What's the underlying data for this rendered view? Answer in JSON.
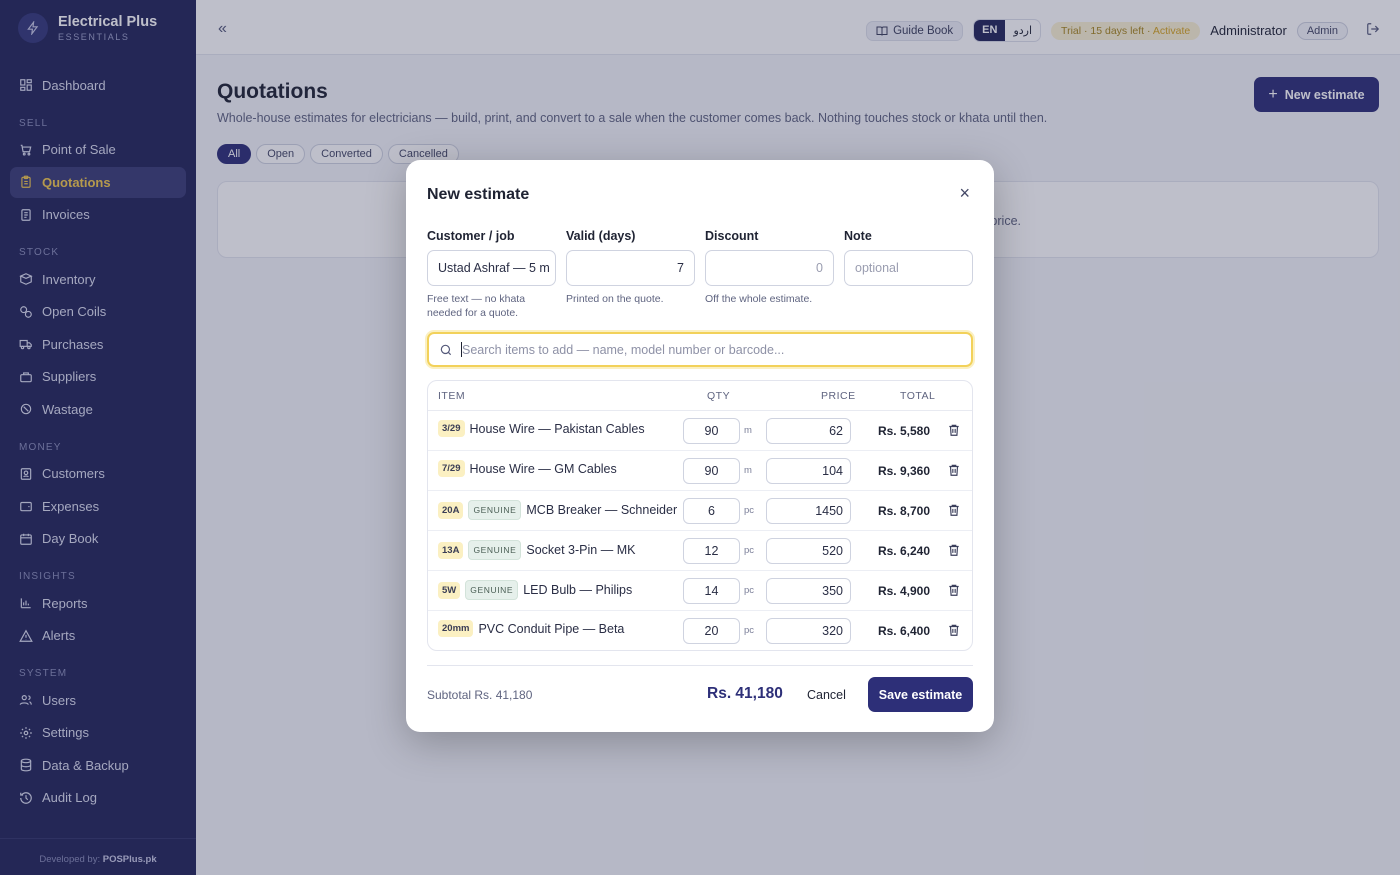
{
  "brand": {
    "title": "Electrical Plus",
    "subtitle": "ESSENTIALS"
  },
  "sidebar": {
    "dashboard": "Dashboard",
    "sections": {
      "sell": "SELL",
      "stock": "STOCK",
      "money": "MONEY",
      "insights": "INSIGHTS",
      "system": "SYSTEM"
    },
    "items": {
      "pos": "Point of Sale",
      "quotations": "Quotations",
      "invoices": "Invoices",
      "inventory": "Inventory",
      "open_coils": "Open Coils",
      "purchases": "Purchases",
      "suppliers": "Suppliers",
      "wastage": "Wastage",
      "customers": "Customers",
      "expenses": "Expenses",
      "day_book": "Day Book",
      "reports": "Reports",
      "alerts": "Alerts",
      "users": "Users",
      "settings": "Settings",
      "data_backup": "Data & Backup",
      "audit_log": "Audit Log"
    },
    "active": "Quotations",
    "developer_prefix": "Developed by:",
    "developer_name": "POSPlus.pk"
  },
  "topbar": {
    "collapse_glyph": "«",
    "guide_book": "Guide Book",
    "lang_en": "EN",
    "lang_ur": "اردو",
    "trial": "Trial · 15 days left ·",
    "trial_action": "Activate",
    "user_name": "Administrator",
    "role": "Admin"
  },
  "page": {
    "title": "Quotations",
    "subtitle": "Whole-house estimates for electricians — build, print, and convert to a sale when the customer comes back. Nothing touches stock or khata until then.",
    "new_button": "New estimate",
    "filters": [
      "All",
      "Open",
      "Converted",
      "Cancelled"
    ],
    "empty_partial": "e price."
  },
  "modal": {
    "title": "New estimate",
    "close_glyph": "×",
    "fields": {
      "customer": {
        "label": "Customer / job",
        "value": "Ustad Ashraf — 5 m",
        "help": "Free text — no khata needed for a quote."
      },
      "valid": {
        "label": "Valid (days)",
        "value": "7",
        "help": "Printed on the quote."
      },
      "discount": {
        "label": "Discount",
        "value": "0",
        "help": "Off the whole estimate."
      },
      "note": {
        "label": "Note",
        "placeholder": "optional"
      }
    },
    "search_placeholder": "Search items to add — name, model number or barcode...",
    "columns": {
      "item": "ITEM",
      "qty": "QTY",
      "price": "PRICE",
      "total": "TOTAL"
    },
    "rows": [
      {
        "tag": "3/29",
        "genuine": "",
        "name": "House Wire — Pakistan Cables",
        "qty": "90",
        "unit": "m",
        "price": "62",
        "total": "Rs. 5,580"
      },
      {
        "tag": "7/29",
        "genuine": "",
        "name": "House Wire — GM Cables",
        "qty": "90",
        "unit": "m",
        "price": "104",
        "total": "Rs. 9,360"
      },
      {
        "tag": "20A",
        "genuine": "GENUINE",
        "name": "MCB Breaker — Schneider",
        "qty": "6",
        "unit": "pc",
        "price": "1450",
        "total": "Rs. 8,700"
      },
      {
        "tag": "13A",
        "genuine": "GENUINE",
        "name": "Socket 3-Pin — MK",
        "qty": "12",
        "unit": "pc",
        "price": "520",
        "total": "Rs. 6,240"
      },
      {
        "tag": "5W",
        "genuine": "GENUINE",
        "name": "LED Bulb — Philips",
        "qty": "14",
        "unit": "pc",
        "price": "350",
        "total": "Rs. 4,900"
      },
      {
        "tag": "20mm",
        "genuine": "",
        "name": "PVC Conduit Pipe — Beta",
        "qty": "20",
        "unit": "pc",
        "price": "320",
        "total": "Rs. 6,400"
      }
    ],
    "subtotal": "Subtotal Rs. 41,180",
    "grand_total": "Rs. 41,180",
    "cancel": "Cancel",
    "save": "Save estimate"
  },
  "colors": {
    "sidebar_bg": "#23265a",
    "primary": "#2d2f78",
    "accent": "#f2c94c"
  }
}
